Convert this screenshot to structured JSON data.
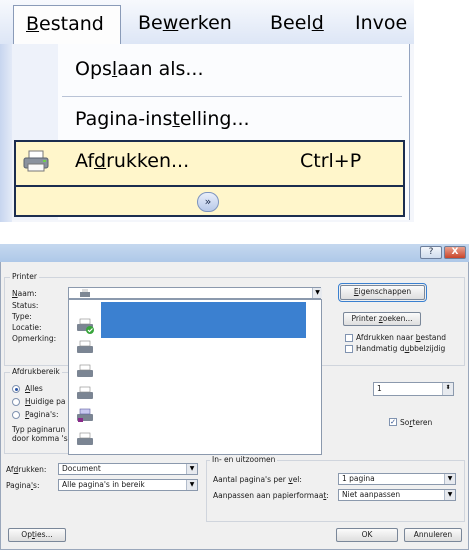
{
  "menu": {
    "menubar": [
      {
        "id": "bestand",
        "pre": "",
        "ul": "B",
        "post": "estand"
      },
      {
        "id": "bewerken",
        "pre": "Be",
        "ul": "w",
        "post": "erken"
      },
      {
        "id": "beeld",
        "pre": "Beel",
        "ul": "d",
        "post": ""
      },
      {
        "id": "invoegen",
        "pre": "Invoe",
        "ul": "",
        "post": ""
      }
    ],
    "items": {
      "opslaan": {
        "pre": "Ops",
        "ul": "l",
        "post": "aan als..."
      },
      "pagina": {
        "pre": "Pagina-ins",
        "ul": "t",
        "post": "elling..."
      },
      "afdrukken": {
        "pre": "Af",
        "ul": "d",
        "post": "rukken..."
      }
    },
    "shortcut": "Ctrl+P",
    "expand_glyph": "»"
  },
  "dialog": {
    "help_glyph": "?",
    "close_glyph": "X",
    "printer_group": "Printer",
    "labels": {
      "naam": {
        "pre": "",
        "ul": "N",
        "post": "aam:"
      },
      "status": "Status:",
      "type": "Type:",
      "locatie": "Locatie:",
      "opmerking": "Opmerking:"
    },
    "properties_btn": {
      "pre": "",
      "ul": "E",
      "post": "igenschappen"
    },
    "find_btn": {
      "pre": "Printer ",
      "ul": "z",
      "post": "oeken..."
    },
    "print_to_file": {
      "pre": "Afdrukken naar ",
      "ul": "b",
      "post": "estand"
    },
    "manual_duplex": {
      "pre": "Handmatig d",
      "ul": "u",
      "post": "bbelzijdig"
    },
    "range_group": "Afdrukbereik",
    "range_all": {
      "pre": "",
      "ul": "A",
      "post": "lles"
    },
    "range_current": {
      "pre": "",
      "ul": "H",
      "post": "uidige pa"
    },
    "range_pages": {
      "pre": "",
      "ul": "P",
      "post": "agina's:"
    },
    "range_hint_1": "Typ paginarun",
    "range_hint_2": "door komma 's",
    "copies_value": "1",
    "collate": {
      "pre": "So",
      "ul": "r",
      "post": "teren"
    },
    "zoom_group": "In- en uitzoomen",
    "print_what_label": {
      "pre": "Af",
      "ul": "d",
      "post": "rukken:"
    },
    "print_what_value": "Document",
    "pages_label": {
      "pre": "Pagina",
      "ul": "'",
      "post": "s:"
    },
    "pages_value": "Alle pagina's in bereik",
    "per_sheet_label": {
      "pre": "Aantal pagina's per ",
      "ul": "v",
      "post": "el:"
    },
    "per_sheet_value": "1 pagina",
    "scale_label": {
      "pre": "Aanpassen aan papierformaa",
      "ul": "t",
      "post": ":"
    },
    "scale_value": "Niet aanpassen",
    "options_btn": {
      "pre": "Op",
      "ul": "t",
      "post": "ies..."
    },
    "ok_btn": "OK",
    "cancel_btn": "Annuleren"
  },
  "colors": {
    "selection": "#3b80d0",
    "menu_highlight": "#fff6cb",
    "accent_border": "#1b2d4f"
  },
  "icons": [
    "printer-icon",
    "printer-check-icon",
    "printer-fax-icon",
    "chevron-down-icon",
    "double-chevron-icon",
    "help-icon",
    "close-icon"
  ]
}
